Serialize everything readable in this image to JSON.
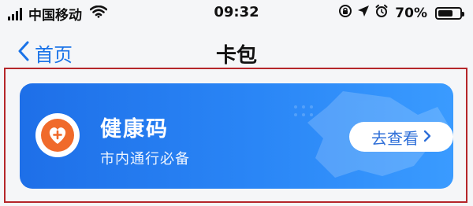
{
  "status_bar": {
    "carrier": "中国移动",
    "time": "09:32",
    "battery_percent": "70%",
    "battery_level": 0.7,
    "icons": [
      "signal-icon",
      "wifi-icon",
      "lock-rotation-icon",
      "location-arrow-icon",
      "alarm-icon",
      "battery-icon"
    ]
  },
  "nav": {
    "back_label": "首页",
    "title": "卡包"
  },
  "card": {
    "title": "健康码",
    "subtitle": "市内通行必备",
    "button_label": "去查看",
    "icon": "health-heart-plus-icon",
    "colors": {
      "card_start": "#1e6fe8",
      "card_end": "#3a9bff",
      "icon_orange": "#f06a2b",
      "highlight_border": "#b5262a"
    }
  }
}
